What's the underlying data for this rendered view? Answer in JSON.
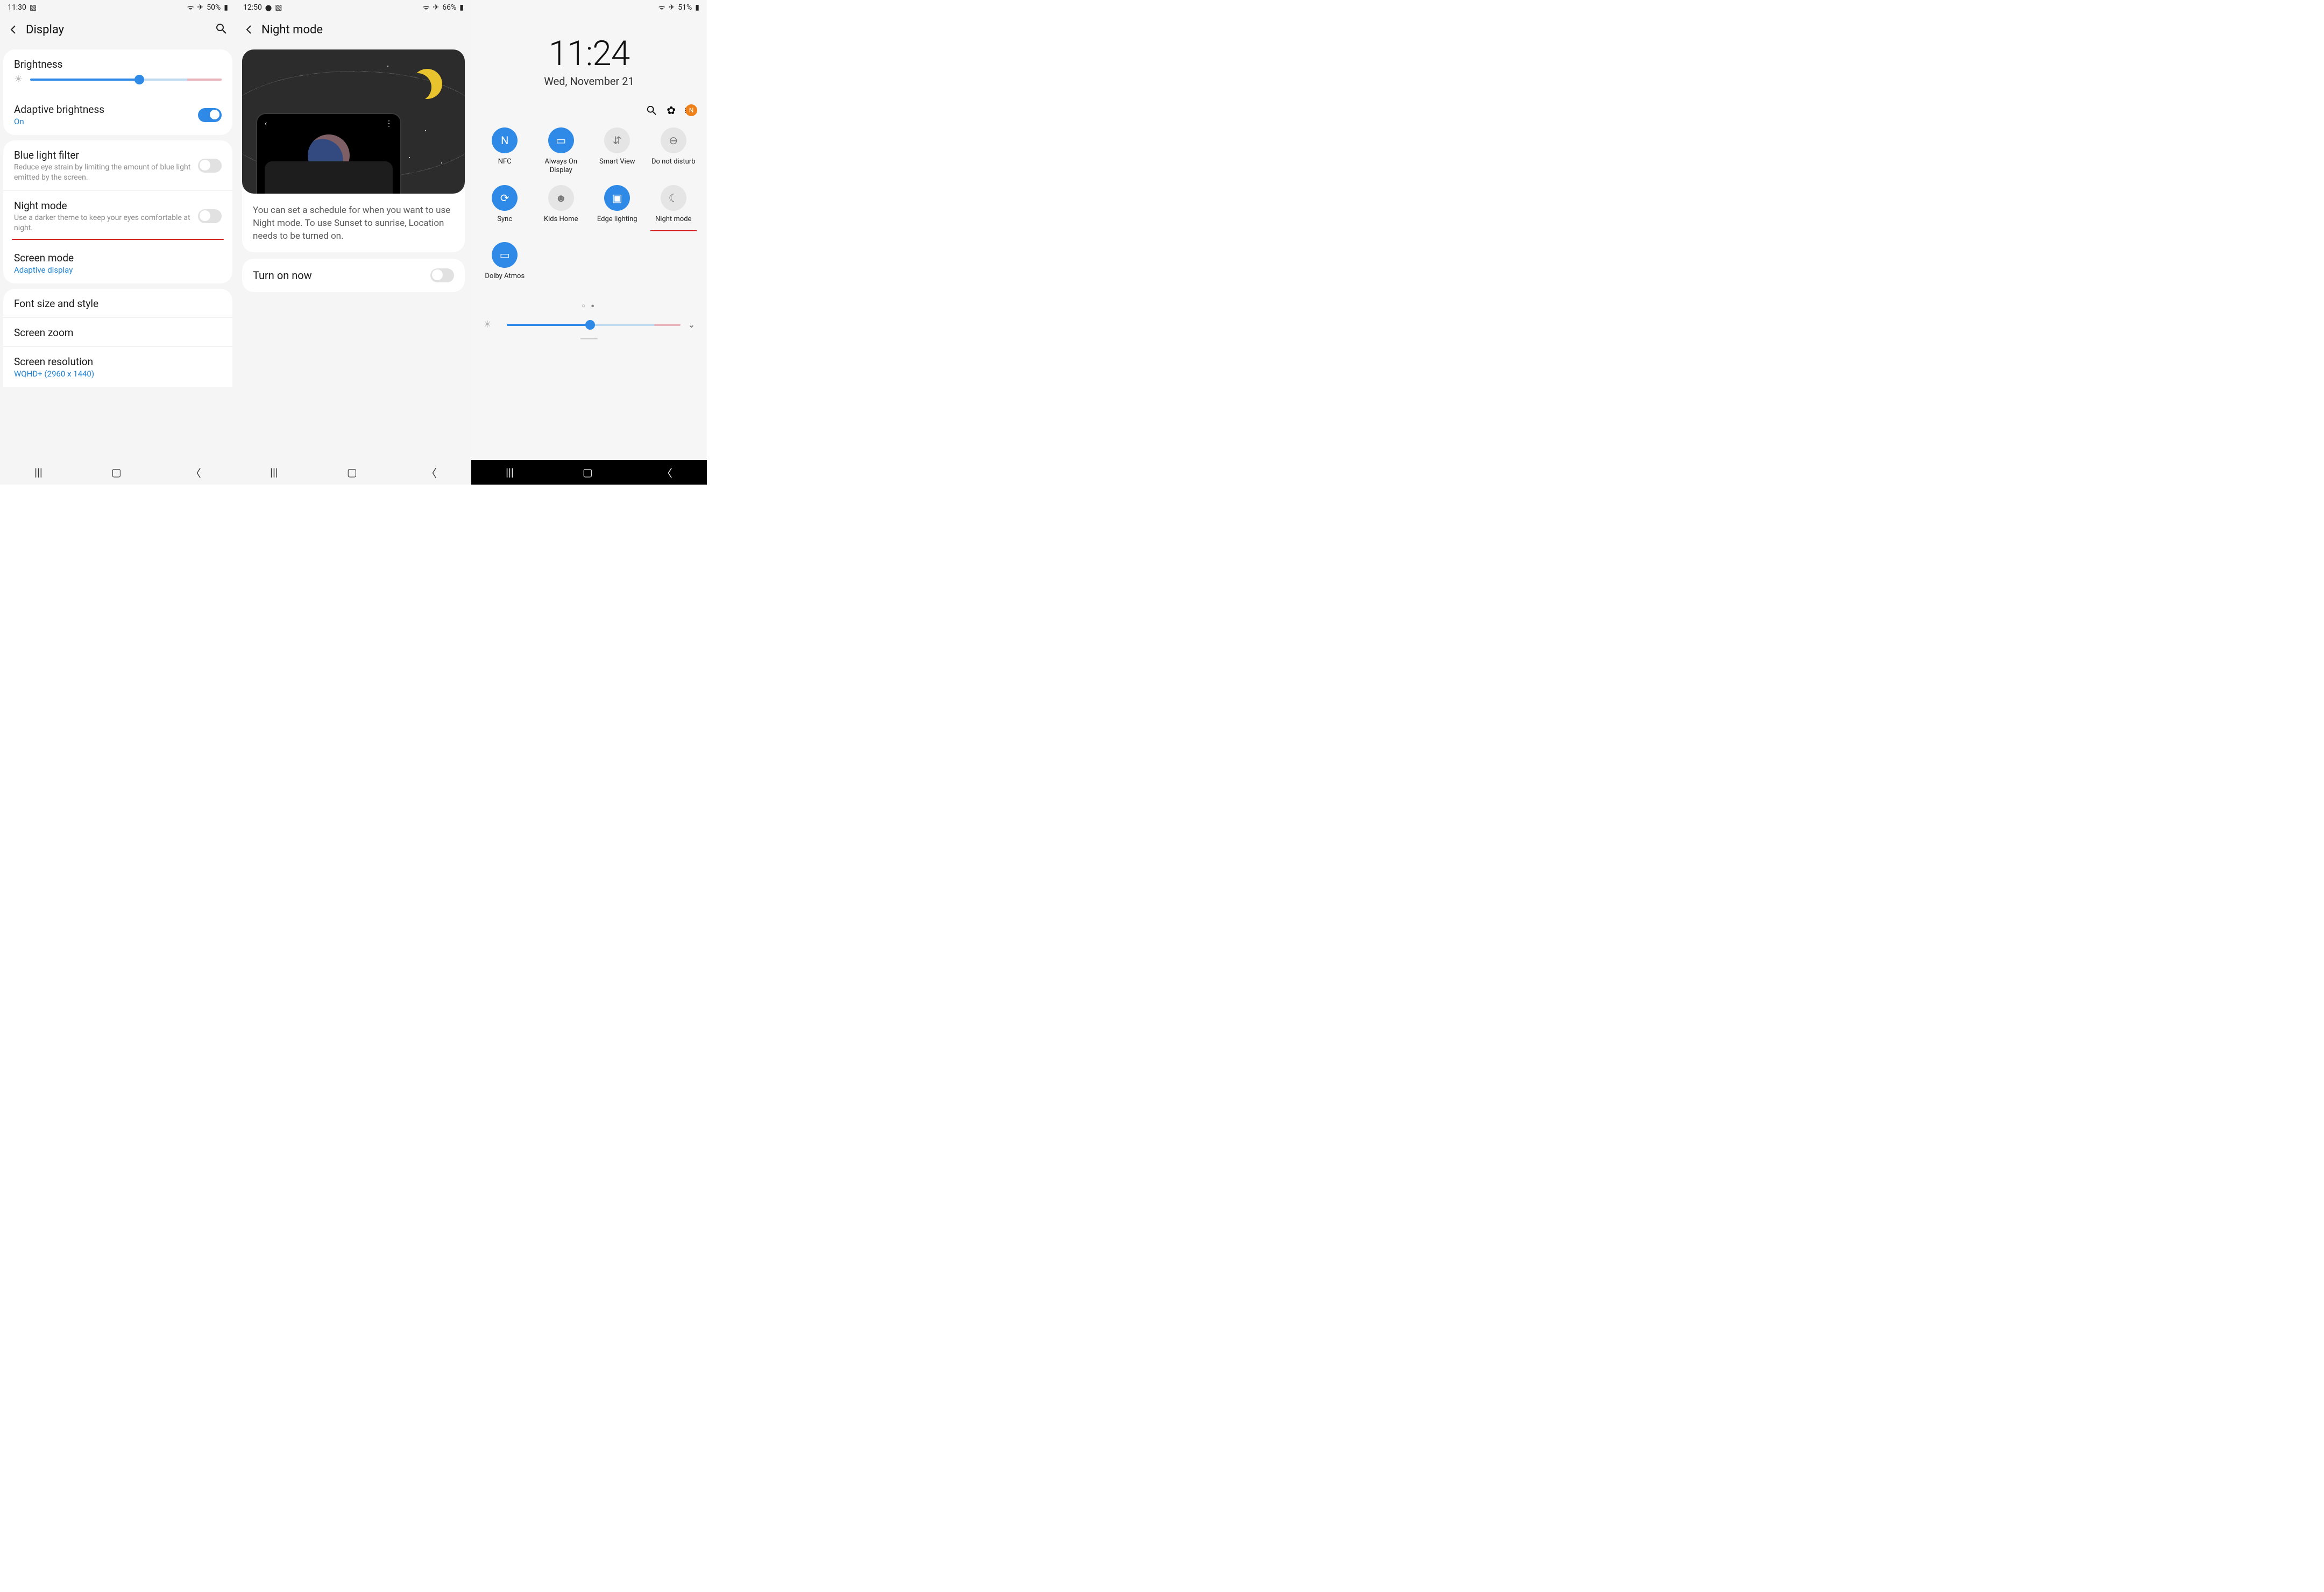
{
  "p1": {
    "status": {
      "time": "11:30",
      "battery": "50%"
    },
    "title": "Display",
    "brightness_label": "Brightness",
    "adaptive": {
      "title": "Adaptive brightness",
      "value": "On"
    },
    "bluelight": {
      "title": "Blue light filter",
      "sub": "Reduce eye strain by limiting the amount of blue light emitted by the screen."
    },
    "nightmode": {
      "title": "Night mode",
      "sub": "Use a darker theme to keep your eyes comfortable at night."
    },
    "screenmode": {
      "title": "Screen mode",
      "value": "Adaptive display"
    },
    "font": "Font size and style",
    "zoom": "Screen zoom",
    "res": {
      "title": "Screen resolution",
      "value": "WQHD+ (2960 x 1440)"
    }
  },
  "p2": {
    "status": {
      "time": "12:50",
      "battery": "66%"
    },
    "title": "Night mode",
    "note": "You can set a schedule for when you want to use Night mode. To use Sunset to sunrise, Location needs to be turned on.",
    "turnon": "Turn on now"
  },
  "p3": {
    "status": {
      "battery": "51%"
    },
    "clock_time": "11:24",
    "clock_date": "Wed, November 21",
    "tiles": [
      {
        "label": "NFC",
        "on": true,
        "glyph": "N"
      },
      {
        "label": "Always On Display",
        "on": true,
        "glyph": "▭"
      },
      {
        "label": "Smart View",
        "on": false,
        "glyph": "⇵"
      },
      {
        "label": "Do not disturb",
        "on": false,
        "glyph": "⊖"
      },
      {
        "label": "Sync",
        "on": true,
        "glyph": "⟳"
      },
      {
        "label": "Kids Home",
        "on": false,
        "glyph": "☻"
      },
      {
        "label": "Edge lighting",
        "on": true,
        "glyph": "▣"
      },
      {
        "label": "Night mode",
        "on": false,
        "glyph": "☾",
        "underline": true
      },
      {
        "label": "Dolby Atmos",
        "on": true,
        "glyph": "▭"
      }
    ]
  }
}
